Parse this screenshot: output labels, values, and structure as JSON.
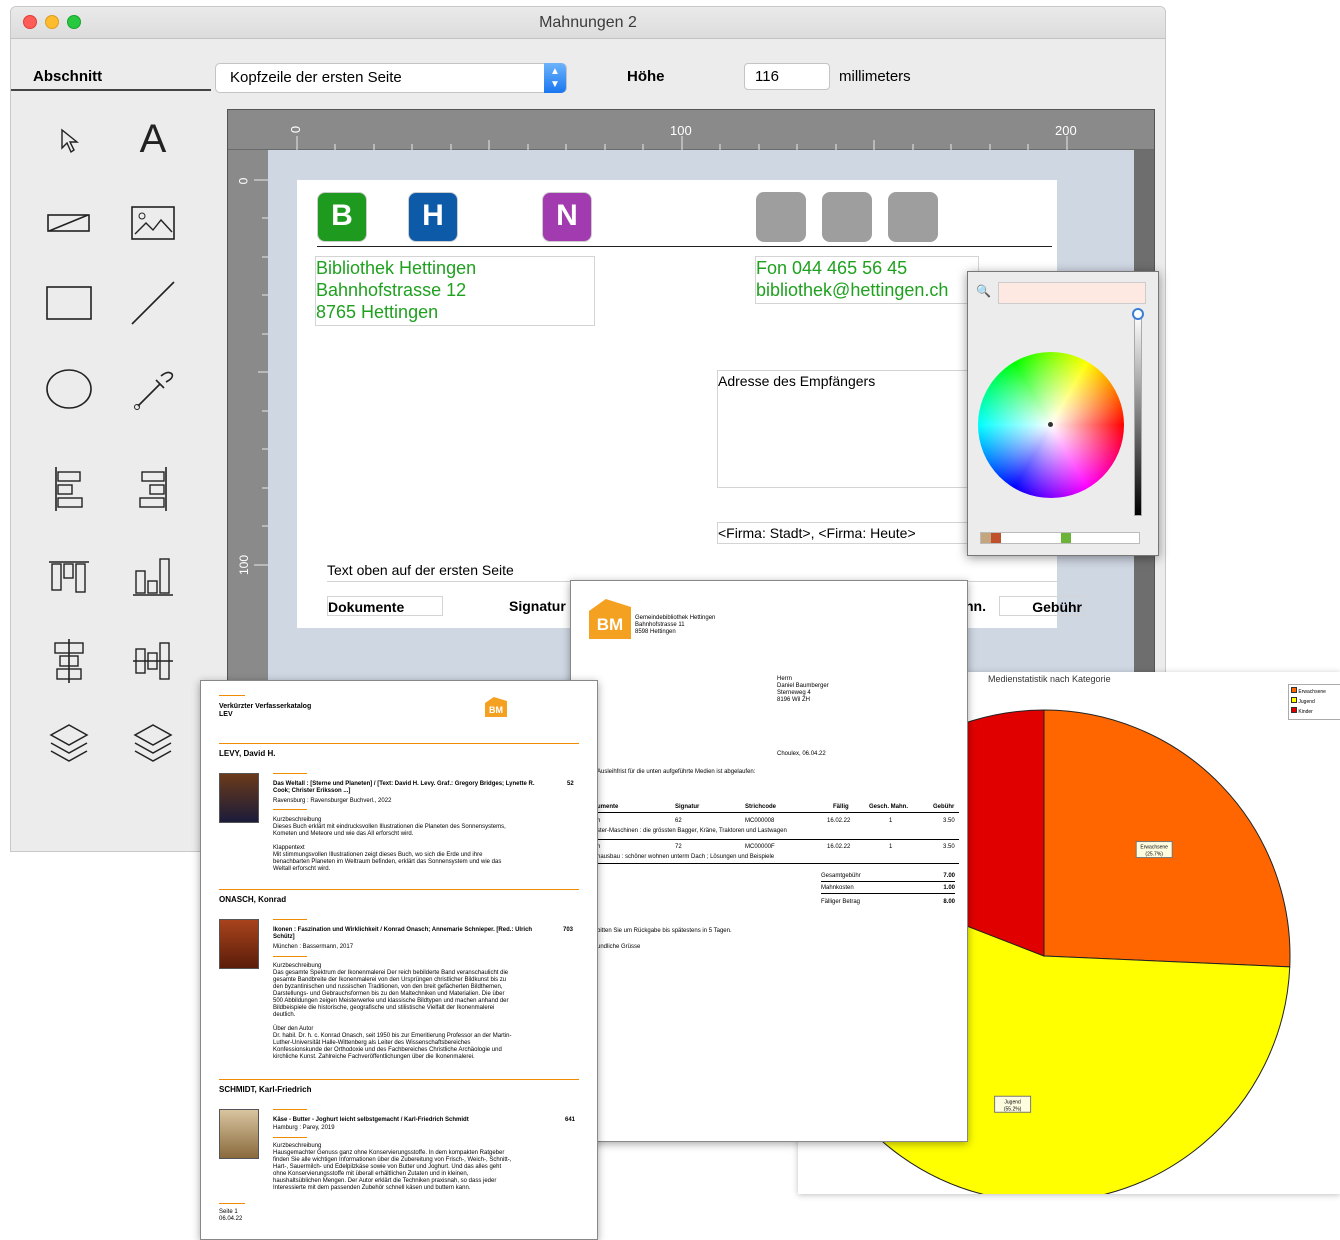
{
  "window": {
    "title": "Mahnungen 2"
  },
  "toolbar": {
    "section_label": "Abschnitt",
    "section_value": "Kopfzeile der ersten Seite",
    "height_label": "Höhe",
    "height_value": "116",
    "unit_label": "millimeters"
  },
  "tools": [
    "pointer-icon",
    "text-icon",
    "field-icon",
    "image-icon",
    "rectangle-icon",
    "line-icon",
    "oval-icon",
    "eyedropper-icon",
    "align-left-icon",
    "align-right-icon",
    "align-top-icon",
    "align-bottom-icon",
    "center-horizontal-icon",
    "center-vertical-icon",
    "bring-front-icon",
    "send-back-icon"
  ],
  "rulers": {
    "top": [
      "0",
      "100",
      "200"
    ],
    "left": [
      "0",
      "100"
    ]
  },
  "header_letters": [
    {
      "letter": "B",
      "color": "#1e9a1e"
    },
    {
      "letter": "H",
      "color": "#0c5aa8"
    },
    {
      "letter": "N",
      "color": "#a23bb0"
    }
  ],
  "library": {
    "name": "Bibliothek Hettingen",
    "street": "Bahnhofstrasse 12",
    "city": "8765 Hettingen",
    "phone": "Fon 044 465 56 45",
    "email": "bibliothek@hettingen.ch"
  },
  "fields": {
    "recipient": "Adresse des Empfängers",
    "city_date": "<Firma: Stadt>, <Firma: Heute>",
    "top_text": "Text oben auf der ersten Seite",
    "col_docs": "Dokumente",
    "col_sig": "Signatur",
    "col_mahn": "hn.",
    "col_fee": "Gebühr"
  },
  "catalog": {
    "title": "Verkürzter Verfasserkatalog",
    "subtitle": "LEV",
    "logo_text": "BM",
    "authors": [
      {
        "name": "LEVY, David H.",
        "title": "Das Weltall : [Sterne und Planeten] / [Text: David H. Levy. Graf.: Gregory Bridges; Lynette R. Cook; Christer Eriksson ...]",
        "pub": "Ravensburg : Ravensburger Buchverl., 2022",
        "num": "52",
        "h1": "Kurzbeschreibung",
        "t1": "Dieses Buch erklärt mit eindrucksvollen Illustrationen die Planeten des Sonnensystems, Kometen und Meteore und wie das All erforscht wird.",
        "h2": "Klappentext",
        "t2": "Mit stimmungsvollen Illustrationen zeigt dieses Buch, wo sich die Erde und ihre benachbarten Planeten im Weltraum befinden, erklärt das Sonnensystem und wie das Weltall erforscht wird."
      },
      {
        "name": "ONASCH, Konrad",
        "title": "Ikonen : Faszination und Wirklichkeit / Konrad Onasch; Annemarie Schnieper. [Red.: Ulrich Schütz]",
        "pub": "München : Bassermann, 2017",
        "num": "703",
        "h1": "Kurzbeschreibung",
        "t1": "Das gesamte Spektrum der Ikonenmalerei Der reich bebilderte Band veranschaulicht die gesamte Bandbreite der Ikonenmalerei von den Ursprüngen christlicher Bildkunst bis zu den byzantinischen und russischen Traditionen, von den breit gefächerten Bildthemen, Darstellungs- und Gebrauchsformen bis zu den Maltechniken und Materialien. Die über 500 Abbildungen zeigen Meisterwerke und klassische Bildtypen und machen anhand der Bildbeispiele die historische, geografische und stilistische Vielfalt der Ikonenmalerei deutlich.",
        "h2": "Über den Autor",
        "t2": "Dr. habil. Dr. h. c. Konrad Onasch, seit 1950 bis zur Emeritierung Professor an der Martin-Luther-Universität Halle-Wittenberg als Leiter des Wissenschaftsbereiches Konfessionskunde der Orthodoxie und des Fachbereiches Christliche Archäologie und kirchliche Kunst. Zahlreiche Fachveröffentlichungen über die Ikonenmalerei."
      },
      {
        "name": "SCHMIDT, Karl-Friedrich",
        "title": "Käse - Butter - Joghurt leicht selbstgemacht / Karl-Friedrich Schmidt",
        "pub": "Hamburg : Parey, 2019",
        "num": "641",
        "h1": "Kurzbeschreibung",
        "t1": "Hausgemachter Genuss ganz ohne Konservierungsstoffe. In dem kompakten Ratgeber finden Sie alle wichtigen Informationen über die Zubereitung von Frisch-, Weich-, Schnitt-, Hart-, Sauermilch- und Edelpilzkäse sowie von Butter und Joghurt. Und das alles geht ohne Konservierungsstoffe mit überall erhältlichen Zutaten und in kleinen, haushaltsüblichen Mengen. Der Autor erklärt die Techniken praxisnah, so dass jeder Interessierte mit dem passenden Zubehör schnell käsen und buttern kann.",
        "h2": "",
        "t2": ""
      }
    ],
    "footer_page": "Seite 1",
    "footer_date": "06.04.22"
  },
  "letter": {
    "logo_text": "BM",
    "lib_name": "Gemeindebibliothek Hettingen",
    "lib_street": "Bahnhofstrasse 11",
    "lib_city": "8598 Hettingen",
    "addr1": "Herrn",
    "addr2": "Daniel Baumberger",
    "addr3": "Sterneweg 4",
    "addr4": "8196 Wil ZH",
    "date": "Choulex, 06.04.22",
    "intro": "Ausleihfrist für die unten aufgeführte Medien ist abgelaufen:",
    "headers": [
      "umente",
      "Signatur",
      "Strichcode",
      "Fällig",
      "Gesch. Mahn.",
      "Gebühr"
    ],
    "rows": [
      {
        "a": "h",
        "sig": "62",
        "code": "MC000008",
        "due": "16.02.22",
        "m": "1",
        "fee": "3.50",
        "desc": "ster-Maschinen : die grössten Bagger, Kräne, Traktoren und Lastwagen"
      },
      {
        "a": "h",
        "sig": "72",
        "code": "MC00000F",
        "due": "16.02.22",
        "m": "1",
        "fee": "3.50",
        "desc": "hausbau : schöner wohnen unterm Dach ; Lösungen und Beispiele"
      }
    ],
    "sum_fee_label": "Gesamtgebühr",
    "sum_fee": "7.00",
    "costs_label": "Mahnkosten",
    "costs": "1.00",
    "due_label": "Fälliger Betrag",
    "due_total": "8.00",
    "closing": "bitten Sie um Rückgabe bis spätestens in 5 Tagen.",
    "greeting": "undliche Grüsse"
  },
  "chart_data": {
    "type": "pie",
    "title": "Medienstatistik nach Kategorie",
    "categories": [
      "Erwachsene",
      "Jugend",
      "Kinder"
    ],
    "values": [
      25.7,
      55.2,
      19.1
    ],
    "labels": [
      "Erwachsene\n(25.7%)",
      "Jugend\n(55.2%)",
      ""
    ],
    "colors": [
      "#ff6600",
      "#ffff00",
      "#e00000"
    ],
    "legend": "top-right"
  }
}
